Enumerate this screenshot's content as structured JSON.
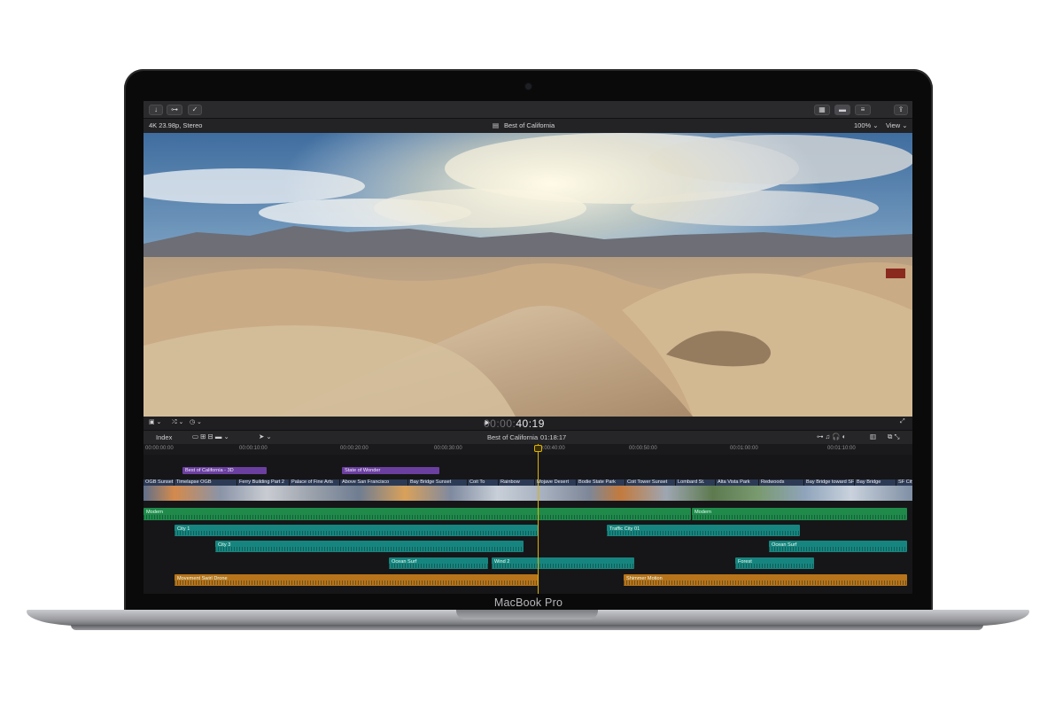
{
  "device": {
    "chin_label": "MacBook Pro"
  },
  "app": {
    "toolbar": {
      "buttons": [
        "import-icon",
        "keywords-icon",
        "checkmark-icon",
        "browser-icon",
        "timeline-icon",
        "inspector-icon",
        "share-icon"
      ]
    },
    "viewer": {
      "format": "4K 23.98p, Stereo",
      "project_title": "Best of California",
      "zoom": "100% ⌄",
      "view": "View ⌄"
    },
    "playback": {
      "timecode_prefix": "00:00:",
      "timecode": "40:19"
    },
    "timeline_toolbar": {
      "index_label": "Index",
      "project_name": "Best of California",
      "duration": "01:18:17"
    },
    "ruler": [
      "00:00:00:00",
      "00:00:10:00",
      "00:00:20:00",
      "00:00:30:00",
      "00:00:40:00",
      "00:00:50:00",
      "00:01:00:00",
      "00:01:10:00"
    ],
    "roles": [
      {
        "label": "Best of California - 3D"
      },
      {
        "label": "State of Wonder"
      }
    ],
    "clips": [
      "OGB Sunset",
      "Timelapse OGB",
      "Ferry Building Part 2",
      "Palace of Fine Arts",
      "Above San Francisco",
      "Bay Bridge Sunset",
      "Coit To",
      "Rainbow",
      "Mojave Desert",
      "Bodie State Park",
      "Coit Tower Sunset",
      "Lombard St.",
      "Alta Vista Park",
      "Redwoods",
      "Bay Bridge toward SF",
      "Bay Bridge",
      "SF City"
    ],
    "music": {
      "a": "Modern",
      "b": "Modern"
    },
    "audio": {
      "city1": "City 1",
      "traffic": "Traffic City 01",
      "city3": "City 3",
      "ocean_surf_right": "Ocean Surf",
      "ocean_surf": "Ocean Surf",
      "wind2": "Wind 2",
      "forest": "Forest",
      "movement": "Movement Swirl Drone",
      "shimmer": "Shimmer Motion"
    }
  }
}
